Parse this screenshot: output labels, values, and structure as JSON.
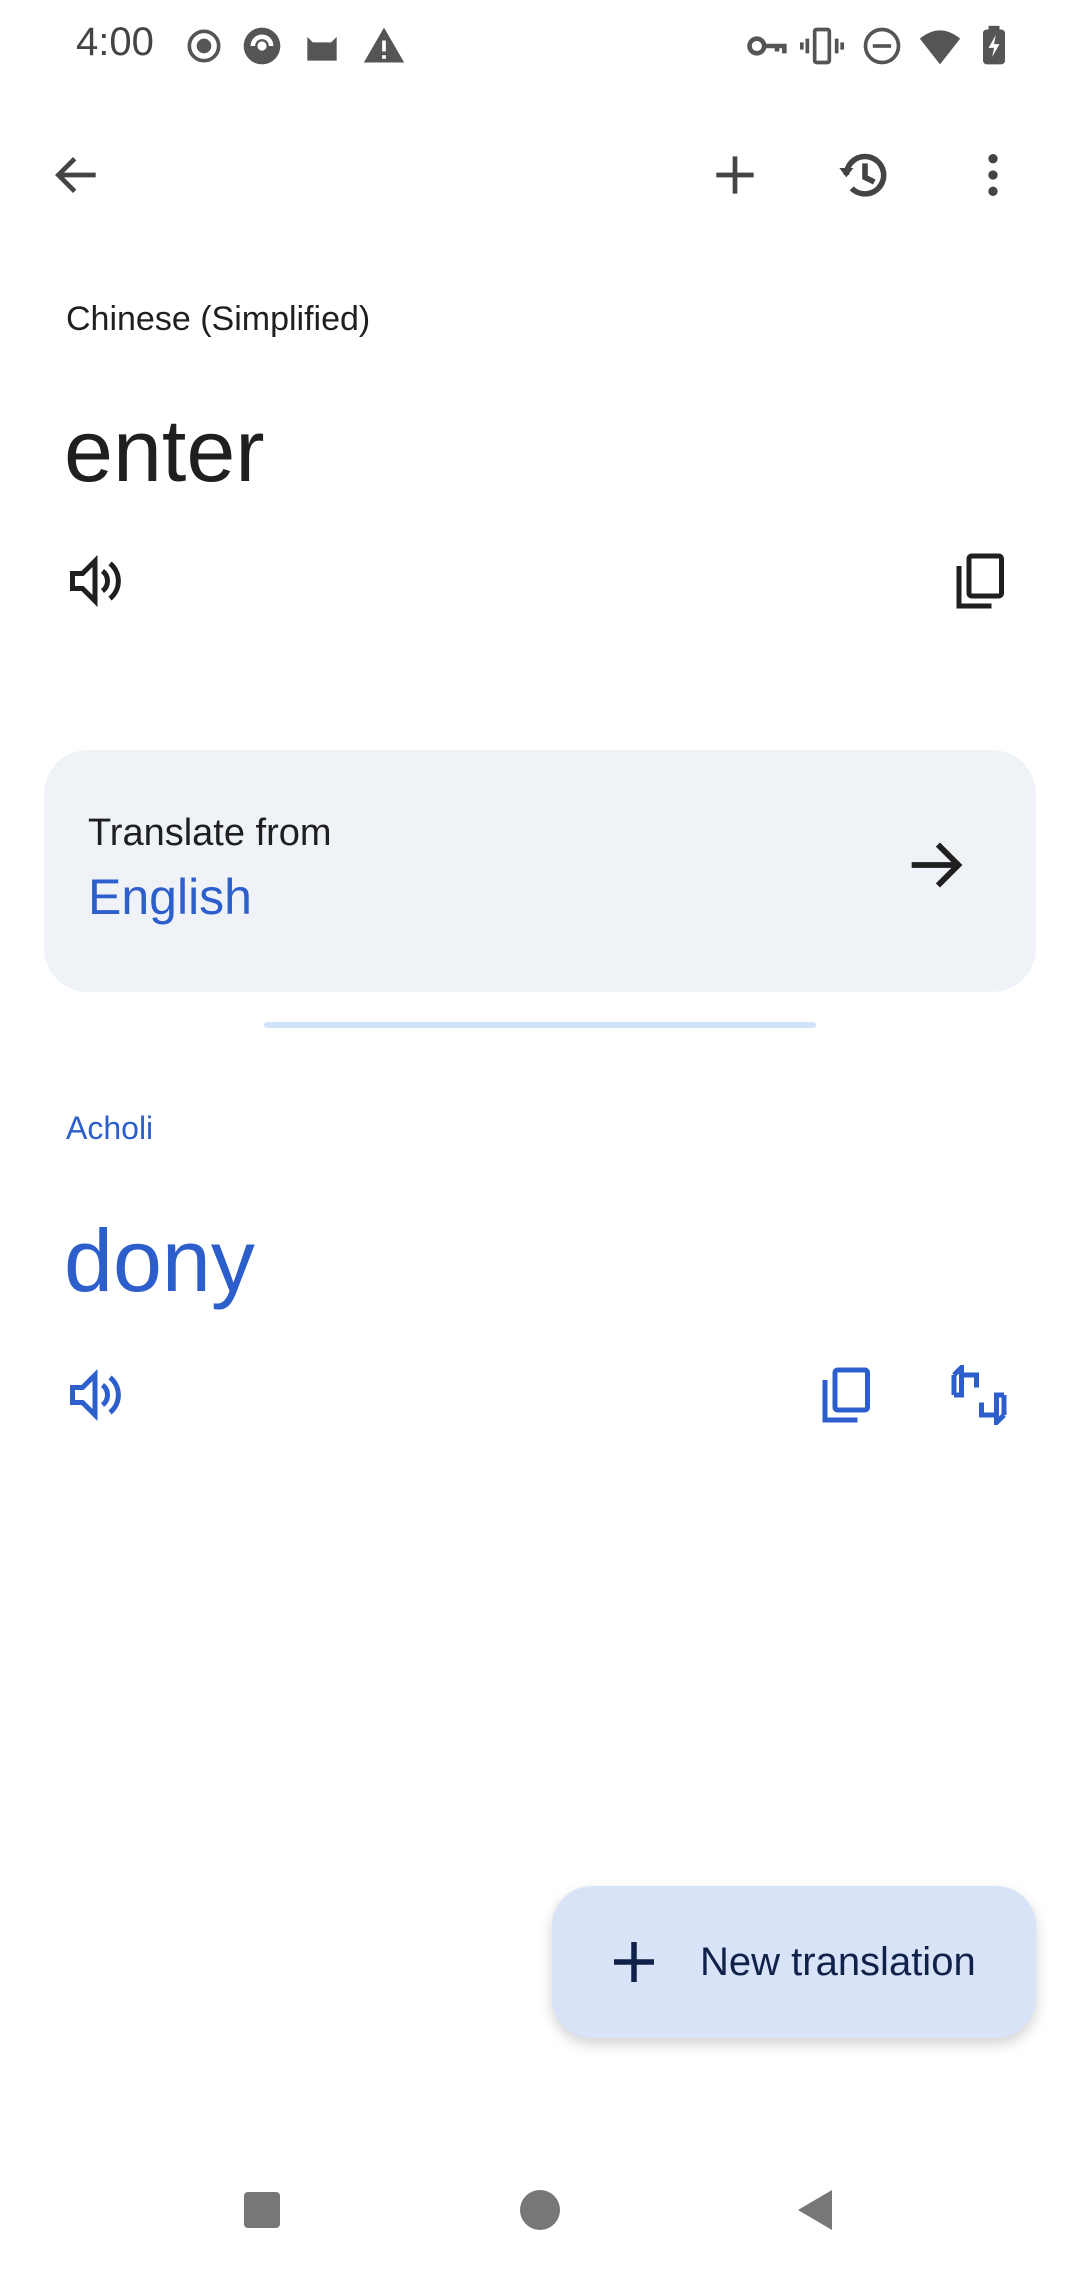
{
  "status_bar": {
    "time": "4:00",
    "left_icons": [
      "record-icon",
      "camera-app-icon",
      "cat-icon",
      "warning-icon"
    ],
    "right_icons": [
      "vpn-key-icon",
      "vibrate-icon",
      "do-not-disturb-icon",
      "wifi-icon",
      "battery-charging-icon"
    ]
  },
  "toolbar": {
    "back_icon": "arrow-left-icon",
    "new_icon": "plus-icon",
    "history_icon": "history-icon",
    "more_icon": "more-vert-icon"
  },
  "source": {
    "language": "Chinese (Simplified)",
    "text": "enter"
  },
  "translate_from": {
    "label": "Translate from",
    "language": "English"
  },
  "target": {
    "language": "Acholi",
    "text": "dony"
  },
  "fab": {
    "label": "New translation"
  },
  "colors": {
    "accent": "#2d5fcc",
    "card_bg": "#eff3f8",
    "fab_bg": "#d8e3f8"
  }
}
